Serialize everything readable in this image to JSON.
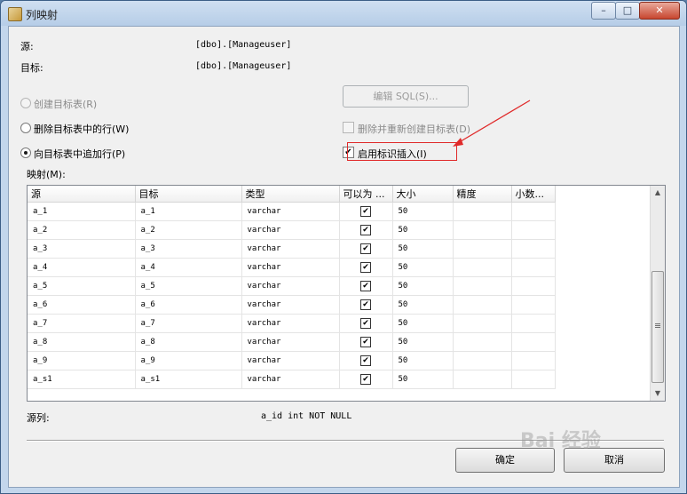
{
  "window": {
    "title": "列映射",
    "minimize": "–",
    "maximize": "□",
    "close": "✕"
  },
  "info": {
    "source_label": "源:",
    "source_value": "[dbo].[Manageuser]",
    "target_label": "目标:",
    "target_value": "[dbo].[Manageuser]"
  },
  "options": {
    "create_table": "创建目标表(R)",
    "delete_rows": "删除目标表中的行(W)",
    "append_rows": "向目标表中追加行(P)",
    "edit_sql": "编辑 SQL(S)...",
    "drop_recreate": "删除并重新创建目标表(D)",
    "identity_insert": "启用标识插入(I)",
    "identity_checked": true,
    "selected_radio": "append_rows"
  },
  "mapping": {
    "label": "映射(M):",
    "columns": [
      "源",
      "目标",
      "类型",
      "可以为 ...",
      "大小",
      "精度",
      "小数..."
    ],
    "rows": [
      {
        "source": "a_1",
        "target": "a_1",
        "type": "varchar",
        "nullable": true,
        "size": "50"
      },
      {
        "source": "a_2",
        "target": "a_2",
        "type": "varchar",
        "nullable": true,
        "size": "50"
      },
      {
        "source": "a_3",
        "target": "a_3",
        "type": "varchar",
        "nullable": true,
        "size": "50"
      },
      {
        "source": "a_4",
        "target": "a_4",
        "type": "varchar",
        "nullable": true,
        "size": "50"
      },
      {
        "source": "a_5",
        "target": "a_5",
        "type": "varchar",
        "nullable": true,
        "size": "50"
      },
      {
        "source": "a_6",
        "target": "a_6",
        "type": "varchar",
        "nullable": true,
        "size": "50"
      },
      {
        "source": "a_7",
        "target": "a_7",
        "type": "varchar",
        "nullable": true,
        "size": "50"
      },
      {
        "source": "a_8",
        "target": "a_8",
        "type": "varchar",
        "nullable": true,
        "size": "50"
      },
      {
        "source": "a_9",
        "target": "a_9",
        "type": "varchar",
        "nullable": true,
        "size": "50"
      },
      {
        "source": "a_s1",
        "target": "a_s1",
        "type": "varchar",
        "nullable": true,
        "size": "50"
      }
    ]
  },
  "source_column": {
    "label": "源列:",
    "value": "a_id int NOT NULL"
  },
  "buttons": {
    "ok": "确定",
    "cancel": "取消"
  },
  "watermark": "Bai 经验",
  "colors": {
    "annotation_red": "#e02a2a",
    "window_frame": "#b4cbe6"
  }
}
